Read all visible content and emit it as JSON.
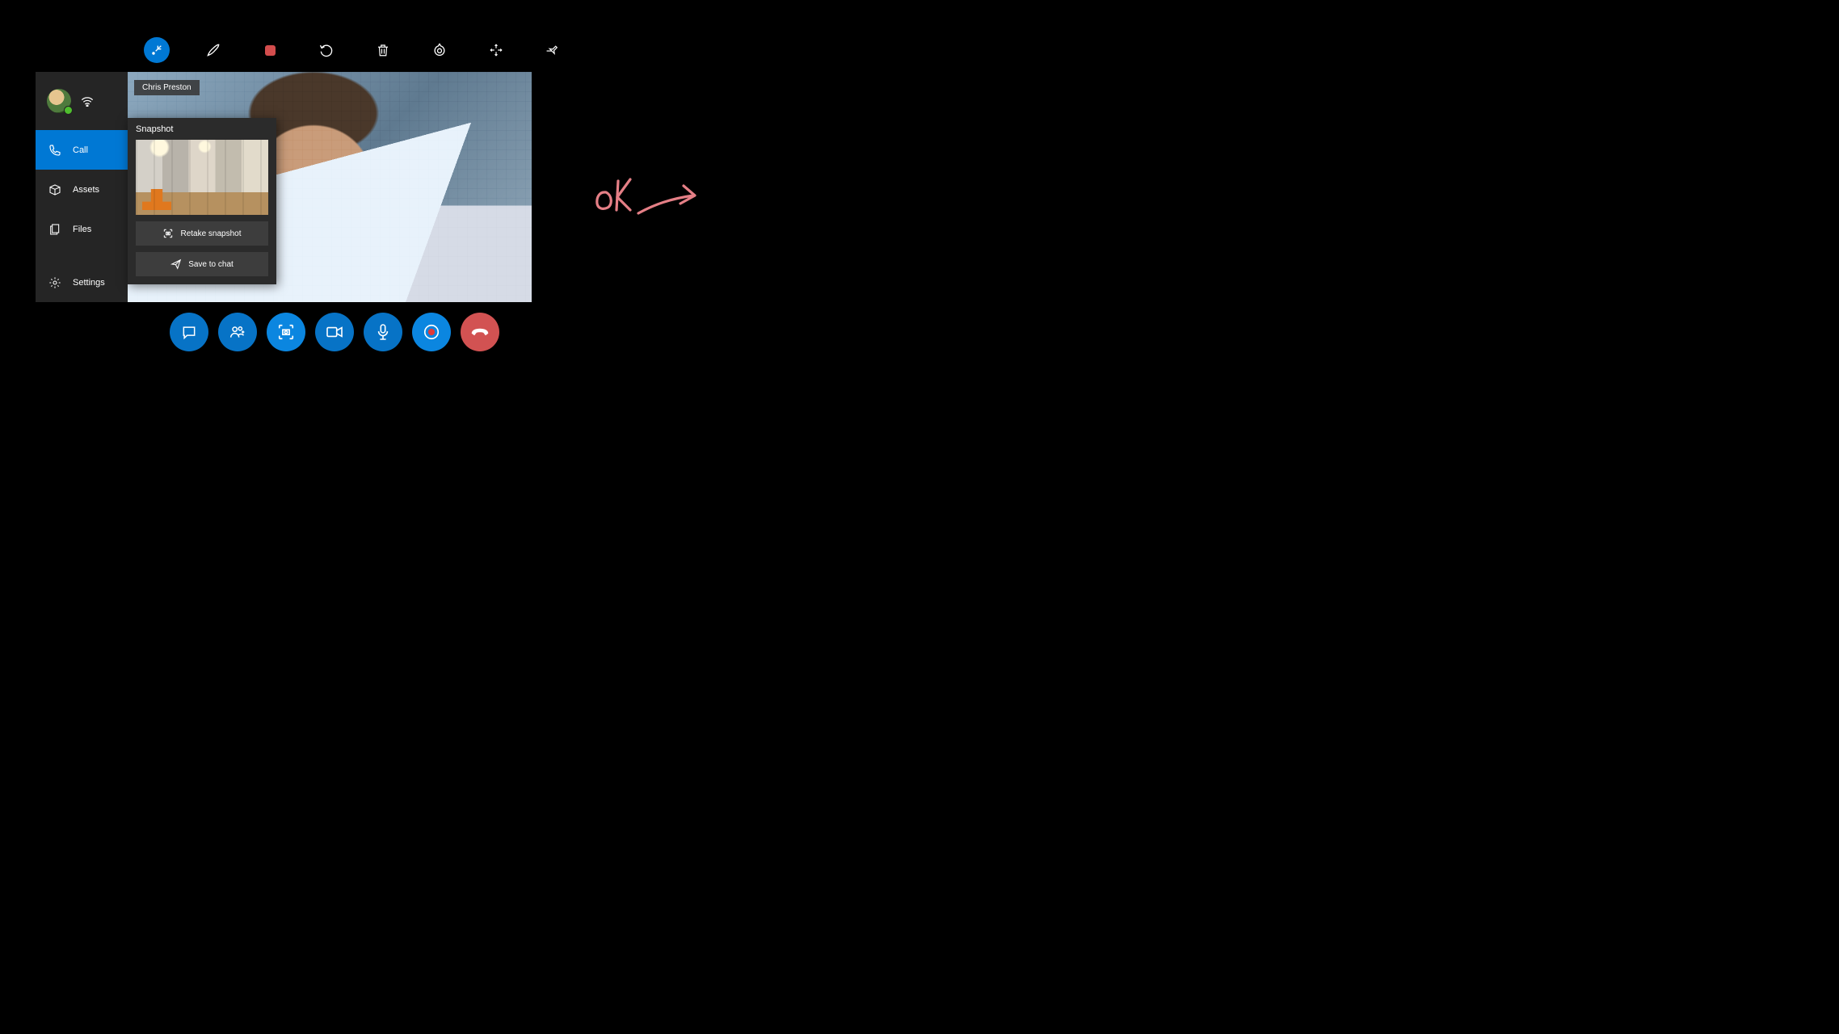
{
  "toolbar": {
    "items": [
      "collapse",
      "pen",
      "stop",
      "undo",
      "delete",
      "target",
      "fullscreen",
      "pin"
    ]
  },
  "caller": {
    "name": "Chris Preston"
  },
  "sidebar": {
    "items": [
      {
        "label": "Call"
      },
      {
        "label": "Assets"
      },
      {
        "label": "Files"
      },
      {
        "label": "Settings"
      }
    ]
  },
  "snapshot": {
    "title": "Snapshot",
    "retake_label": "Retake snapshot",
    "save_label": "Save to chat"
  },
  "callbar": {
    "items": [
      "chat",
      "add-people",
      "snapshot",
      "video",
      "mic",
      "record",
      "hangup"
    ]
  },
  "annotation": {
    "text": "OK"
  }
}
